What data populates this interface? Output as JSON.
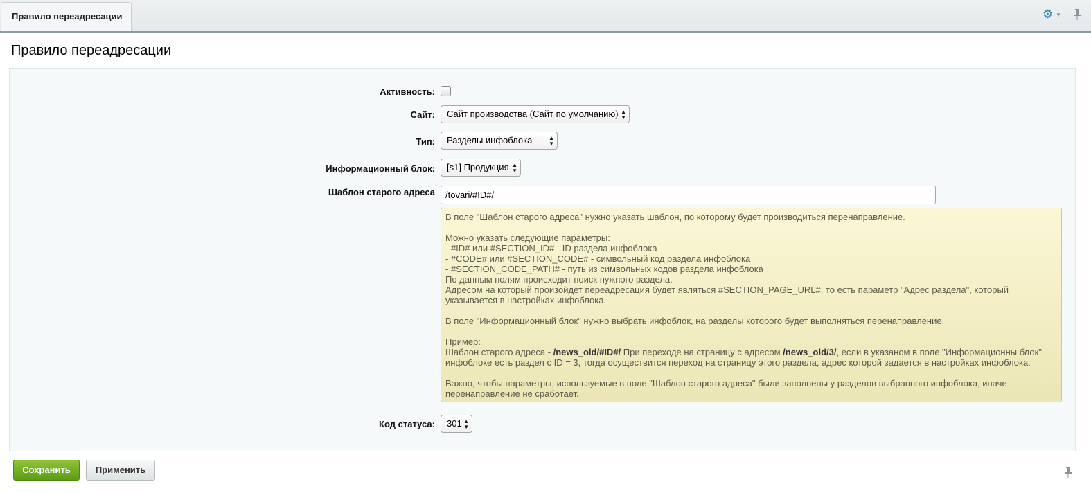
{
  "tab": {
    "label": "Правило переадресации"
  },
  "page": {
    "title": "Правило переадресации"
  },
  "form": {
    "active": {
      "label": "Активность:",
      "checked": false
    },
    "site": {
      "label": "Сайт:",
      "value": "Сайт производства (Сайт по умолчанию)"
    },
    "type": {
      "label": "Тип:",
      "value": "Разделы инфоблока"
    },
    "iblock": {
      "label": "Информационный блок:",
      "value": "[s1] Продукция"
    },
    "template": {
      "label": "Шаблон старого адреса",
      "value": "/tovari/#ID#/"
    },
    "status": {
      "label": "Код статуса:",
      "value": "301"
    }
  },
  "hint": {
    "p1": "В поле \"Шаблон старого адреса\" нужно указать шаблон, по которому будет производиться перенаправление.",
    "p2": "Можно указать следующие параметры:",
    "p3": "- #ID# или #SECTION_ID# - ID раздела инфоблока",
    "p4": "- #CODE# или #SECTION_CODE# - символьный код раздела инфоблока",
    "p5": "- #SECTION_CODE_PATH# - путь из символьных кодов раздела инфоблока",
    "p6": "По данным полям происходит поиск нужного раздела.",
    "p7": "Адресом на который произойдет переадресация будет являться #SECTION_PAGE_URL#, то есть параметр \"Адрес раздела\", который указывается в настройках инфоблока.",
    "p8": "В поле \"Информационный блок\" нужно выбрать инфоблок, на разделы которого будет выполняться перенаправление.",
    "p9": "Пример:",
    "ex_a": "Шаблон старого адреса - ",
    "ex_b": "/news_old/#ID#/",
    "ex_c": " При переходе на страницу с адресом ",
    "ex_d": "/news_old/3/",
    "ex_e": ", если в указаном в поле \"Информационны блок\" инфоблоке есть раздел с ID = 3, тогда осуществится переход на страницу этого раздела, адрес которой задается в настройках инфоблока.",
    "p10": "Важно, чтобы параметры, используемые в поле \"Шаблон старого адреса\" были заполнены у разделов выбранного инфоблока, иначе перенаправление не сработает."
  },
  "buttons": {
    "save": "Сохранить",
    "apply": "Применить"
  },
  "colors": {
    "accent": "#2f7fbf",
    "save": "#6aa81f",
    "hint_bg": "#f7f2c8"
  },
  "icons": {
    "settings": "gear-icon",
    "pin": "pin-icon"
  }
}
